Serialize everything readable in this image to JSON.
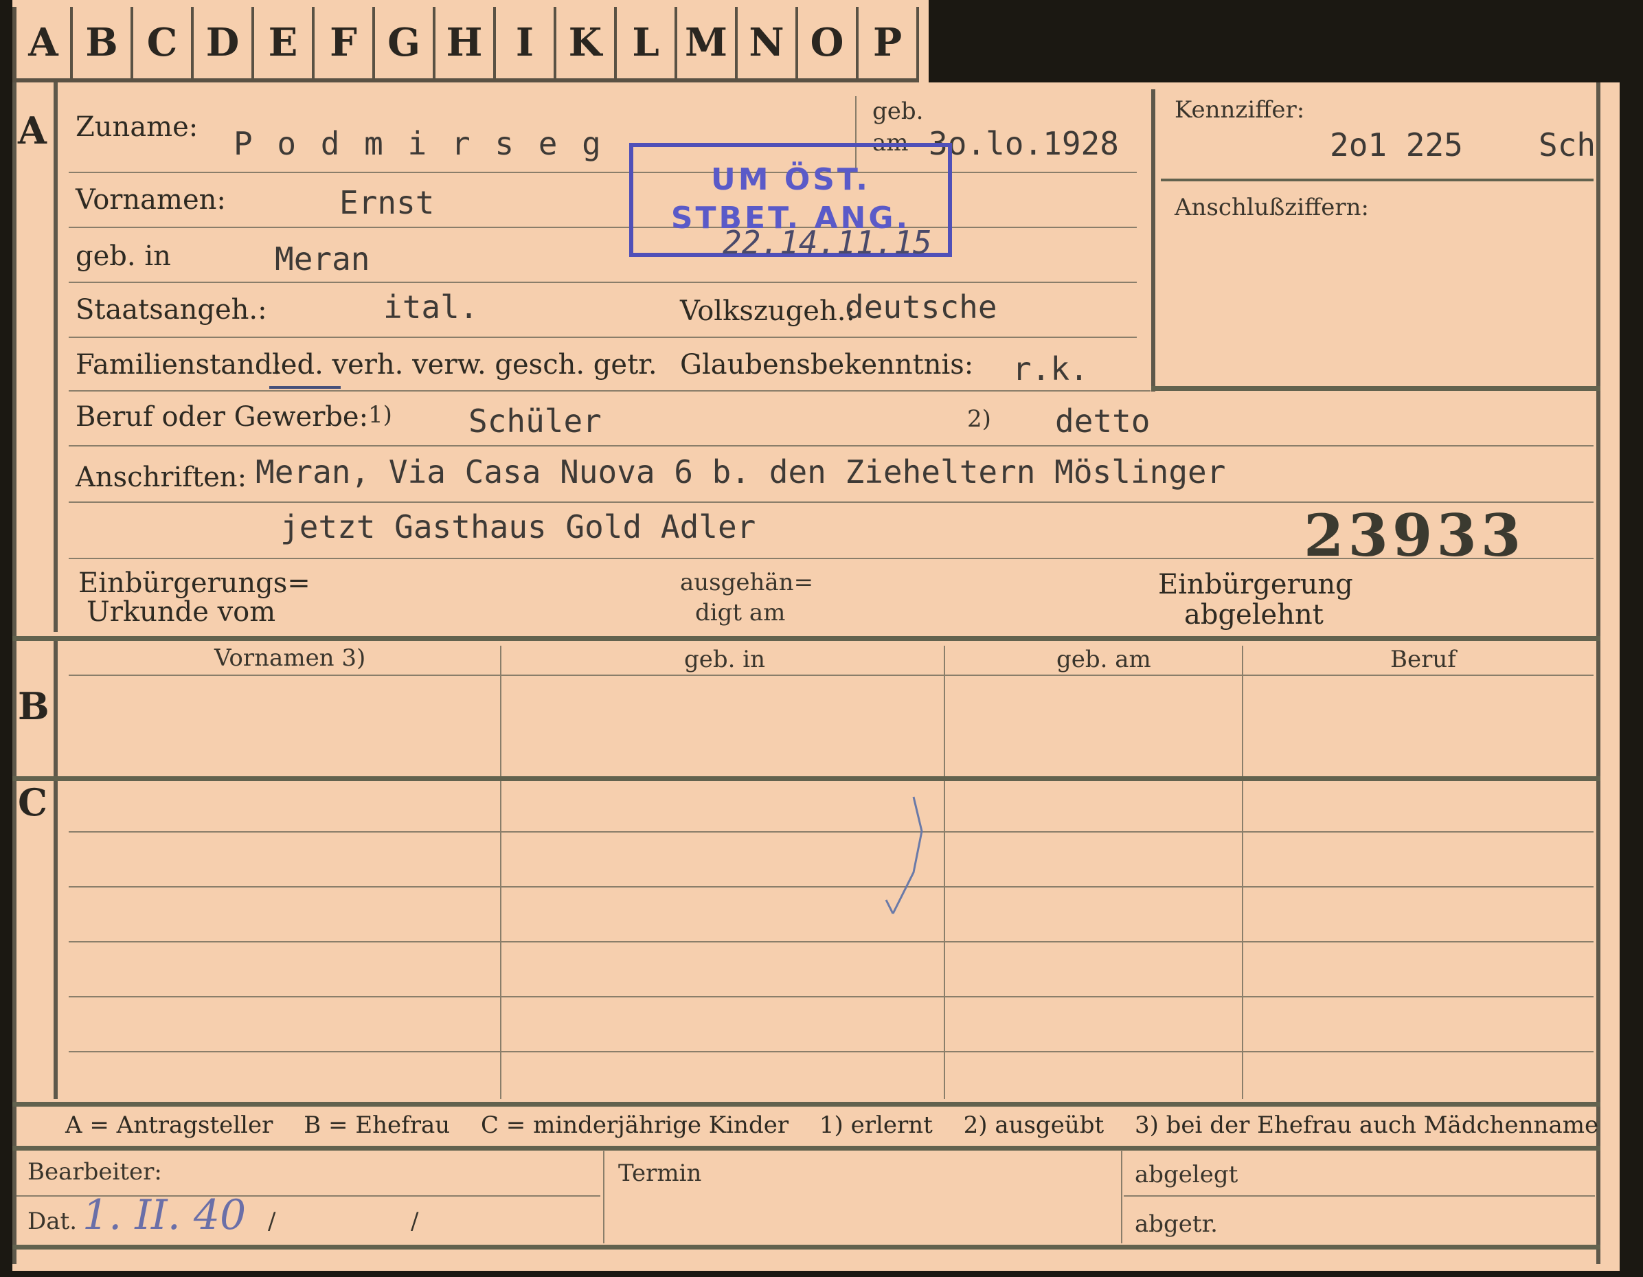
{
  "tabs": [
    "A",
    "B",
    "C",
    "D",
    "E",
    "F",
    "G",
    "H",
    "I",
    "K",
    "L",
    "M",
    "N",
    "O",
    "P"
  ],
  "sections": {
    "a": "A",
    "b": "B",
    "c": "C"
  },
  "person": {
    "zuname_label": "Zuname:",
    "zuname": "P o d m i r s e g",
    "geb_label": "geb.",
    "geb_am_label": "am",
    "geb_am": "3o.lo.1928",
    "vornamen_label": "Vornamen:",
    "vornamen": "Ernst",
    "geb_in_label": "geb. in",
    "geb_in": "Meran",
    "staatsangeh_label": "Staatsangeh.:",
    "staatsangeh": "ital.",
    "volkszugeh_label": "Volkszugeh.:",
    "volkszugeh": "deutsche",
    "familienstand_label": "Familienstand:",
    "familienstand_options": "led. verh. verw. gesch. getr.",
    "glaubens_label": "Glaubensbekenntnis:",
    "glaubens": "r.k.",
    "beruf_label": "Beruf oder Gewerbe:",
    "beruf_sup1": "1)",
    "beruf_erlernt": "Schüler",
    "beruf_sup2": "2)",
    "beruf_ausgeuebt": "detto",
    "anschriften_label": "Anschriften:",
    "anschrift_1": "Meran, Via Casa Nuova 6 b. den Zieheltern Möslinger",
    "anschrift_2": "jetzt Gasthaus Gold Adler",
    "number": "23933"
  },
  "kennziffer": {
    "label": "Kennziffer:",
    "value": "2o1 225",
    "suffix": "Sch"
  },
  "anschlussziffern_label": "Anschlußziffern:",
  "stamp": {
    "line1": "UM ÖST.",
    "line2": "STBET. ANG.",
    "date": "22.14.11.15"
  },
  "einbuergerung": {
    "urkunde_line1": "Einbürgerungs=",
    "urkunde_line2": "Urkunde vom",
    "ausgeh_line1": "ausgehän=",
    "ausgeh_line2": "digt am",
    "abgelehnt_line1": "Einbürgerung",
    "abgelehnt_line2": "abgelehnt"
  },
  "table": {
    "headers": [
      "Vornamen 3)",
      "geb. in",
      "geb. am",
      "Beruf"
    ]
  },
  "legend": {
    "a": "A = Antragsteller",
    "b": "B = Ehefrau",
    "c": "C = minderjährige Kinder",
    "n1": "1) erlernt",
    "n2": "2) ausgeübt",
    "n3": "3) bei der Ehefrau auch Mädchenname"
  },
  "footer": {
    "bearbeiter_label": "Bearbeiter:",
    "termin_label": "Termin",
    "abgelegt_label": "abgelegt",
    "dat_label": "Dat.",
    "dat_value": "1. II. 40",
    "slash1": "/",
    "slash2": "/",
    "abgetr_label": "abgetr."
  }
}
